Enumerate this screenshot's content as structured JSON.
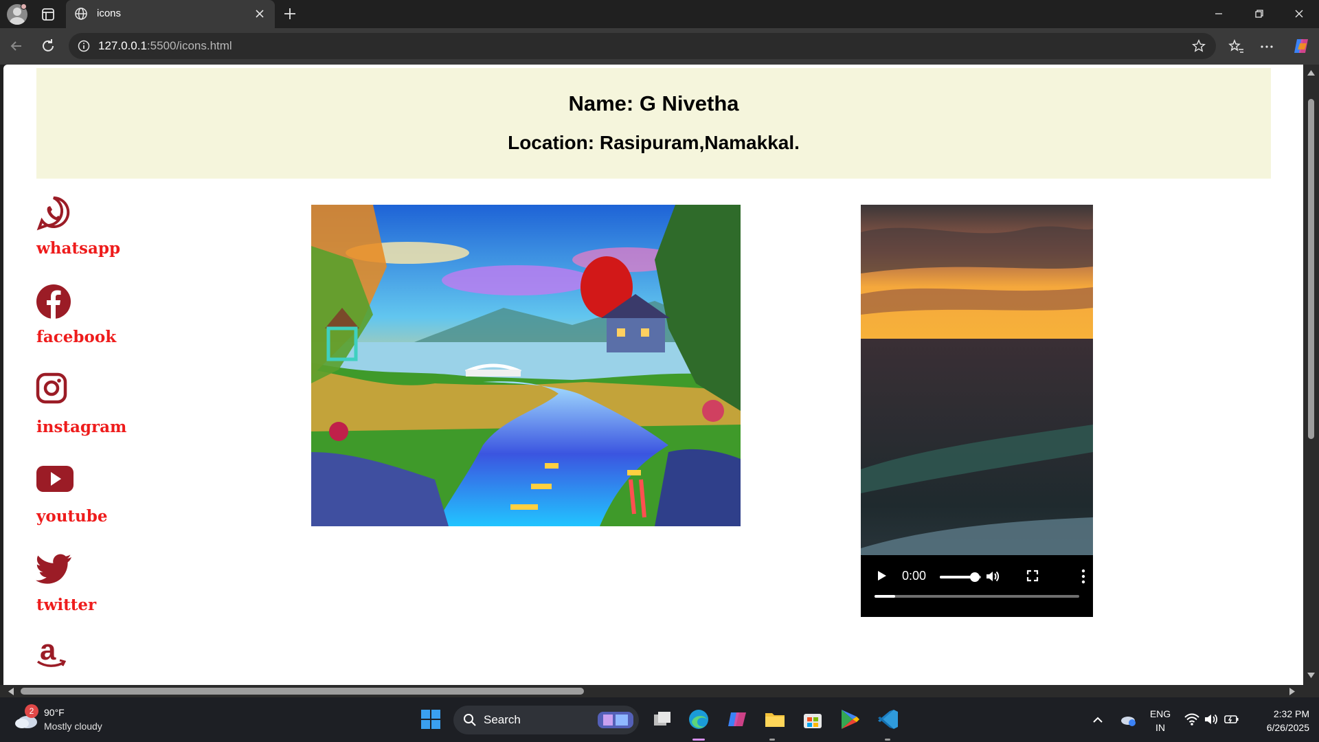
{
  "browser": {
    "tab_title": "icons",
    "url_host": "127.0.0.1",
    "url_rest": ":5500/icons.html"
  },
  "page": {
    "name_line": "Name: G Nivetha",
    "location_line": "Location: Rasipuram,Namakkal.",
    "social_links": [
      {
        "label": "whatsapp",
        "icon": "whatsapp-icon"
      },
      {
        "label": "facebook",
        "icon": "facebook-icon"
      },
      {
        "label": "instagram",
        "icon": "instagram-icon"
      },
      {
        "label": "youtube",
        "icon": "youtube-icon"
      },
      {
        "label": "twitter",
        "icon": "twitter-icon"
      },
      {
        "label": "",
        "icon": "amazon-icon"
      }
    ],
    "video": {
      "time": "0:00",
      "volume_level": 0.85,
      "progress": 0.1
    },
    "colors": {
      "header_bg": "#f5f5dc",
      "label_color": "#ee1c1c",
      "icon_color": "#9b1c26"
    }
  },
  "taskbar": {
    "weather_badge": "2",
    "weather_temp": "90°F",
    "weather_desc": "Mostly cloudy",
    "search_label": "Search",
    "language": "ENG",
    "region": "IN",
    "time": "2:32 PM",
    "date": "6/26/2025"
  }
}
